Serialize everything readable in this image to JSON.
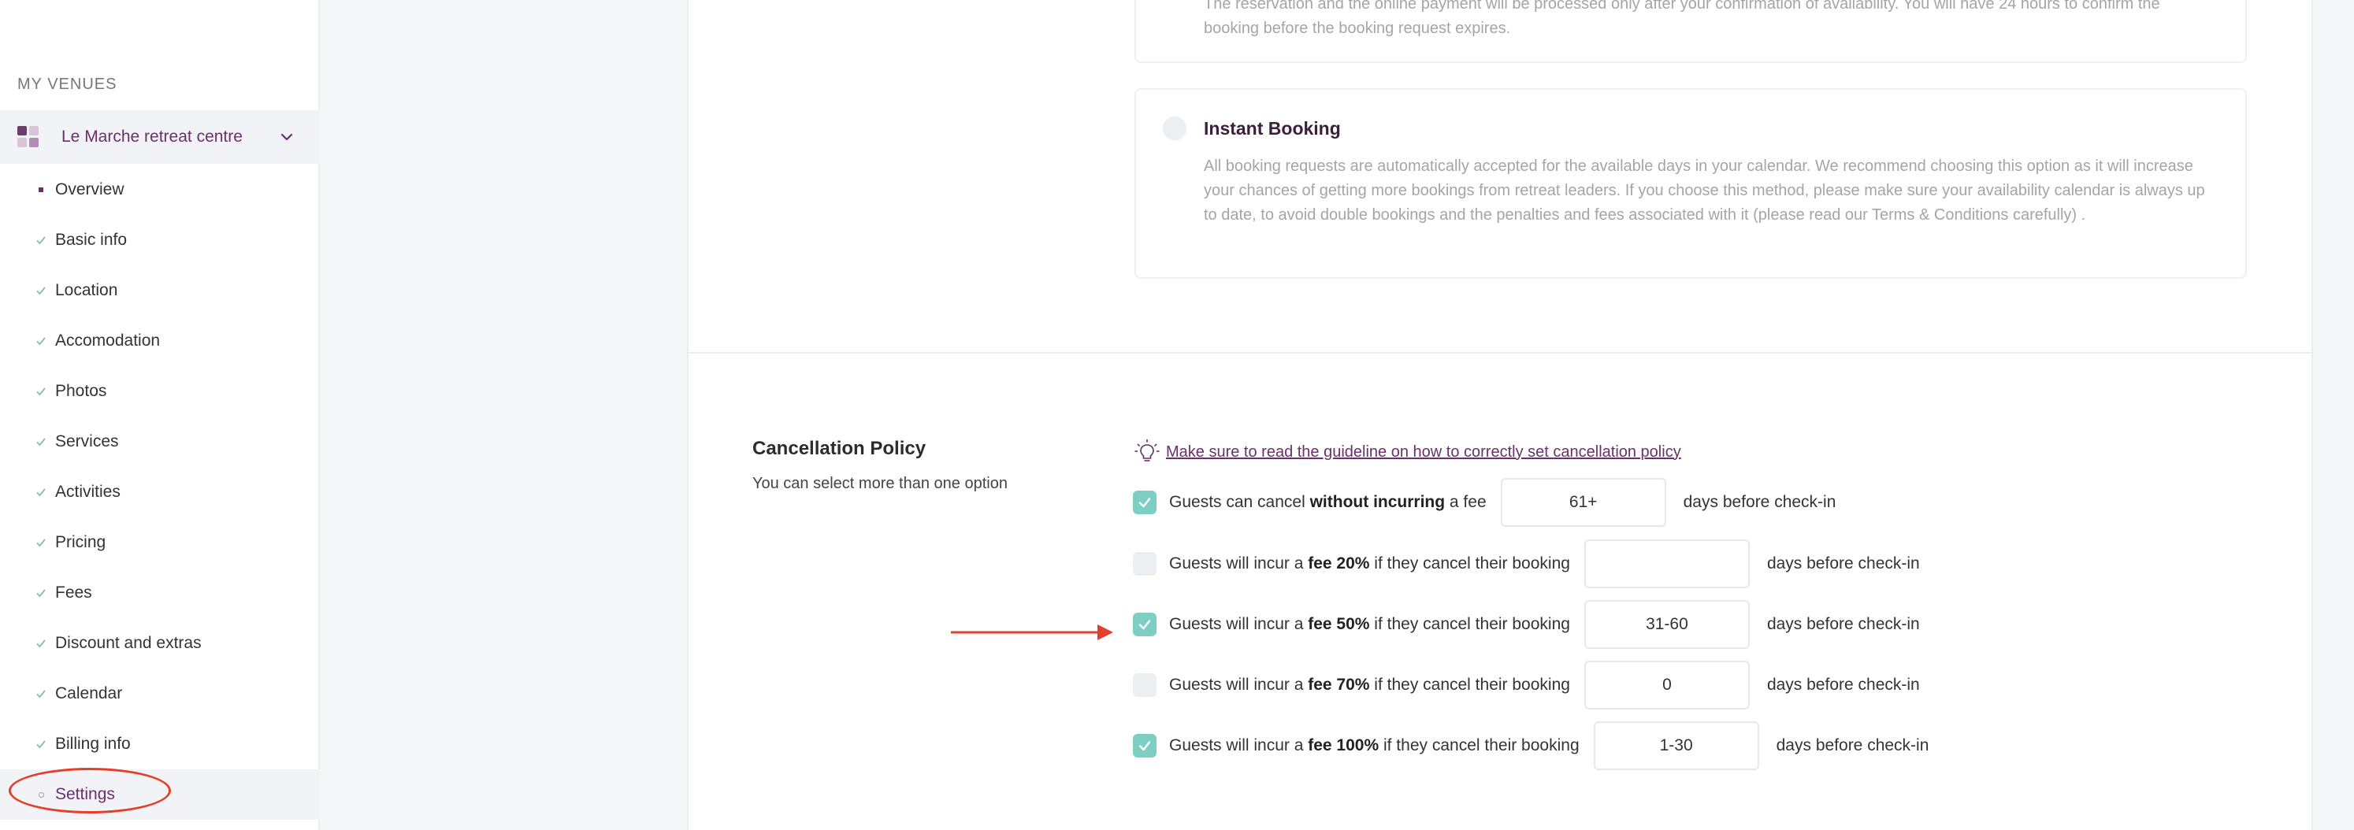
{
  "sidebar": {
    "heading": "MY VENUES",
    "venue_name": "Le Marche retreat centre",
    "items": [
      {
        "label": "Overview",
        "state": "current-section"
      },
      {
        "label": "Basic info",
        "state": "done"
      },
      {
        "label": "Location",
        "state": "done"
      },
      {
        "label": "Accomodation",
        "state": "done"
      },
      {
        "label": "Photos",
        "state": "done"
      },
      {
        "label": "Services",
        "state": "done"
      },
      {
        "label": "Activities",
        "state": "done"
      },
      {
        "label": "Pricing",
        "state": "done"
      },
      {
        "label": "Fees",
        "state": "done"
      },
      {
        "label": "Discount and extras",
        "state": "done"
      },
      {
        "label": "Calendar",
        "state": "done"
      },
      {
        "label": "Billing info",
        "state": "done"
      },
      {
        "label": "Settings",
        "state": "active"
      }
    ]
  },
  "booking": {
    "request_desc": "The reservation and the online payment will be processed only after your confirmation of availability. You will have 24 hours to confirm the booking before the booking request expires.",
    "instant_title": "Instant Booking",
    "instant_desc": "All booking requests are automatically accepted for the available days in your calendar. We recommend choosing this option as it will increase your chances of getting more bookings from retreat leaders. If you choose this method, please make sure your availability calendar is always up to date, to avoid double bookings and the penalties and fees associated with it (please read our Terms & Conditions carefully) ."
  },
  "cancellation": {
    "title": "Cancellation Policy",
    "subtitle": "You can select more than one option",
    "guideline_link": "Make sure to read the guideline on how to correctly set cancellation policy",
    "suffix": "days before check-in",
    "rules": [
      {
        "pre": "Guests can cancel ",
        "bold": "without incurring",
        "post": " a fee",
        "value": "61+",
        "checked": true
      },
      {
        "pre": "Guests will incur a ",
        "bold": "fee 20%",
        "post": " if they cancel their booking",
        "value": "",
        "checked": false
      },
      {
        "pre": "Guests will incur a ",
        "bold": "fee 50%",
        "post": " if they cancel their booking",
        "value": "31-60",
        "checked": true
      },
      {
        "pre": "Guests will incur a ",
        "bold": "fee 70%",
        "post": " if they cancel their booking",
        "value": "0",
        "checked": false
      },
      {
        "pre": "Guests will incur a ",
        "bold": "fee 100%",
        "post": " if they cancel their booking",
        "value": "1-30",
        "checked": true
      }
    ]
  },
  "colors": {
    "accent": "#6b2f6b",
    "check": "#7dcfc4",
    "annotation": "#e3402b"
  }
}
